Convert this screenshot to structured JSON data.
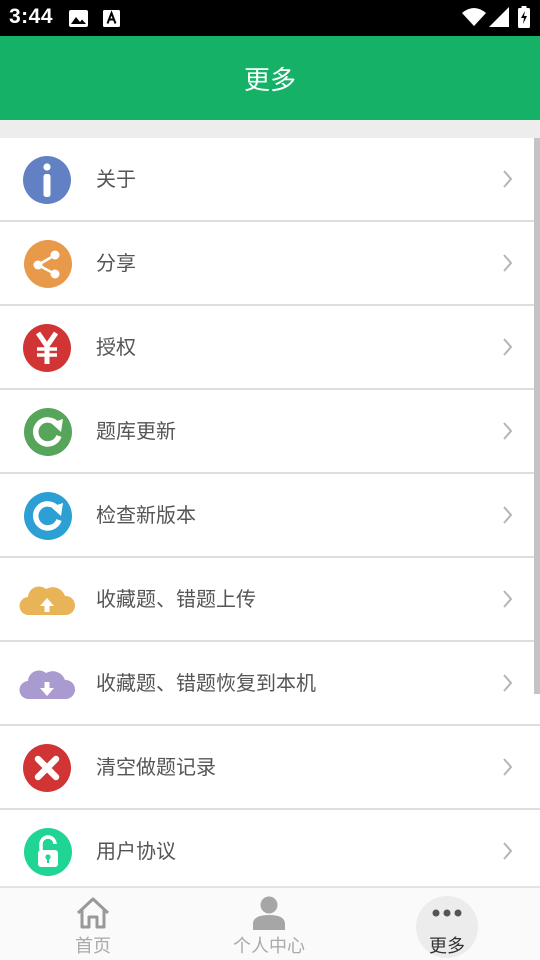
{
  "status_bar": {
    "time": "3:44",
    "icons": [
      "image-icon",
      "text-a-icon",
      "wifi-icon",
      "signal-icon",
      "battery-charging-icon"
    ]
  },
  "header": {
    "title": "更多"
  },
  "menu": {
    "items": [
      {
        "label": "关于",
        "icon": "info-icon",
        "color": "#6181c4"
      },
      {
        "label": "分享",
        "icon": "share-icon",
        "color": "#e8994a"
      },
      {
        "label": "授权",
        "icon": "yen-icon",
        "color": "#d13434"
      },
      {
        "label": "题库更新",
        "icon": "refresh-icon",
        "color": "#56a55b"
      },
      {
        "label": "检查新版本",
        "icon": "refresh-icon",
        "color": "#2c9fd4"
      },
      {
        "label": "收藏题、错题上传",
        "icon": "cloud-upload-icon",
        "color": "#e9b457"
      },
      {
        "label": "收藏题、错题恢复到本机",
        "icon": "cloud-download-icon",
        "color": "#a99bd0"
      },
      {
        "label": "清空做题记录",
        "icon": "close-icon",
        "color": "#d13434"
      },
      {
        "label": "用户协议",
        "icon": "lock-icon",
        "color": "#20d494"
      }
    ]
  },
  "bottom_nav": {
    "items": [
      {
        "label": "首页",
        "icon": "home-icon"
      },
      {
        "label": "个人中心",
        "icon": "user-icon"
      },
      {
        "label": "更多",
        "icon": "more-dots-icon",
        "active": true
      }
    ]
  }
}
